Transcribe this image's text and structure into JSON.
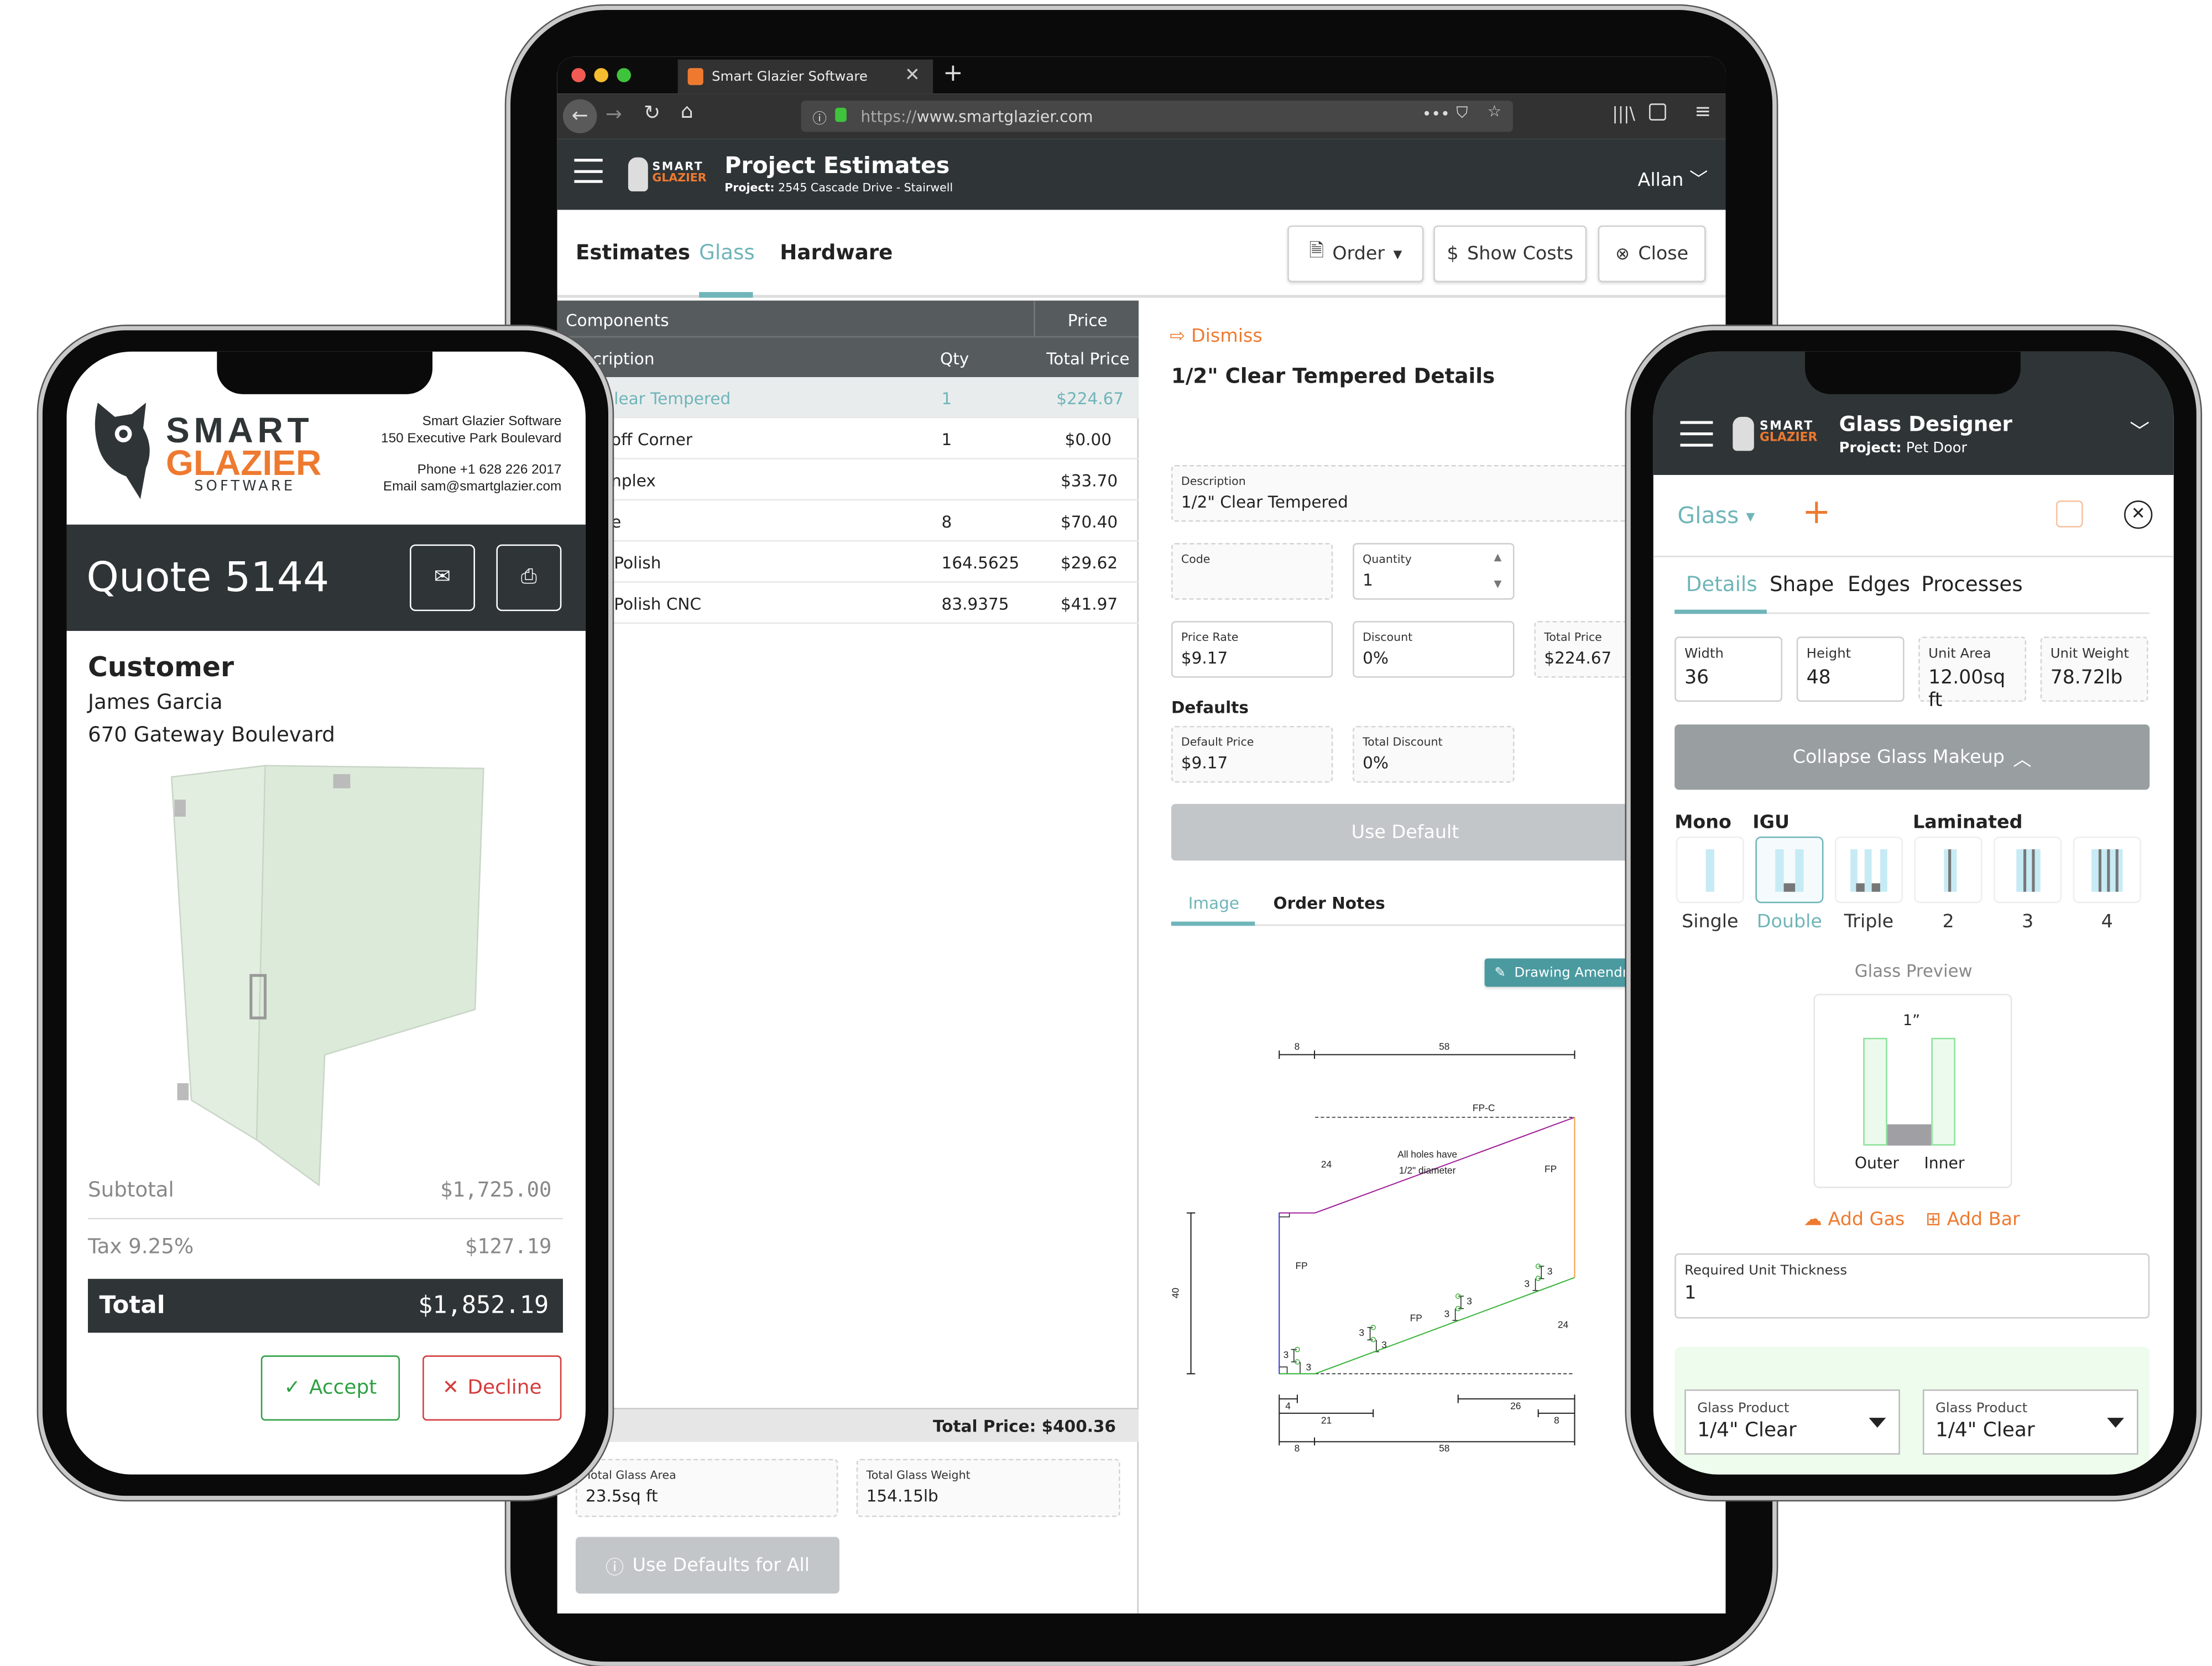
{
  "browser": {
    "tab_title": "Smart Glazier Software",
    "url_prefix": "https://",
    "url": "www.smartglazier.com"
  },
  "app": {
    "title": "Project Estimates",
    "project_label": "Project:",
    "project_value": "2545 Cascade Drive - Stairwell",
    "user": "Allan",
    "logo_text": "SMART GLAZIER SOFTWARE"
  },
  "nav": {
    "tabs": [
      "Estimates",
      "Glass",
      "Hardware"
    ],
    "active_tab": "Glass",
    "order": "Order",
    "show_costs": "Show Costs",
    "close": "Close"
  },
  "table": {
    "group_headers": [
      "Components",
      "Price"
    ],
    "columns": [
      "cription",
      "Qty",
      "Total Price"
    ],
    "rows": [
      {
        "desc": "lear Tempered",
        "qty": "1",
        "price": "$224.67",
        "selected": true
      },
      {
        "desc": "off Corner",
        "qty": "1",
        "price": "$0.00"
      },
      {
        "desc": "nplex",
        "qty": "",
        "price": "$33.70"
      },
      {
        "desc": "e",
        "qty": "8",
        "price": "$70.40"
      },
      {
        "desc": "Polish",
        "qty": "164.5625",
        "price": "$29.62"
      },
      {
        "desc": "Polish CNC",
        "qty": "83.9375",
        "price": "$41.97"
      }
    ],
    "total": "Total Price: $400.36"
  },
  "summary": {
    "area_label": "Total Glass Area",
    "area_value": "23.5sq ft",
    "weight_label": "Total Glass Weight",
    "weight_value": "154.15lb",
    "use_defaults": "Use Defaults for All"
  },
  "details": {
    "dismiss": "Dismiss",
    "title": "1/2\" Clear Tempered Details",
    "description_label": "Description",
    "description_value": "1/2\" Clear Tempered",
    "code_label": "Code",
    "code_value": "",
    "quantity_label": "Quantity",
    "quantity_value": "1",
    "price_rate_label": "Price Rate",
    "price_rate_value": "$9.17",
    "discount_label": "Discount",
    "discount_value": "0%",
    "total_price_label": "Total Price",
    "total_price_value": "$224.67",
    "defaults_heading": "Defaults",
    "default_price_label": "Default Price",
    "default_price_value": "$9.17",
    "total_discount_label": "Total Discount",
    "total_discount_value": "0%",
    "use_default": "Use Default",
    "tabs": [
      "Image",
      "Order Notes"
    ],
    "active_tab": "Image",
    "drawing_amendment": "Drawing Amendr"
  },
  "drawing": {
    "d8": "8",
    "d58": "58",
    "fpc": "FP-C",
    "note1": "All holes have",
    "note2": "1/2\" diameter",
    "d24": "24",
    "fp": "FP",
    "d40": "40",
    "d3": "3",
    "d4": "4",
    "d21": "21",
    "d26": "26"
  },
  "quote": {
    "company": "Smart Glazier Software",
    "address": "150 Executive Park Boulevard",
    "phone": "Phone +1 628 226 2017",
    "email": "Email sam@smartglazier.com",
    "logo_smart": "SMART",
    "logo_glazier": "GLAZIER",
    "logo_software": "SOFTWARE",
    "title": "Quote 5144",
    "customer_heading": "Customer",
    "customer_name": "James Garcia",
    "customer_address": "670 Gateway Boulevard",
    "subtotal_label": "Subtotal",
    "subtotal_value": "$1,725.00",
    "tax_label": "Tax 9.25%",
    "tax_value": "$127.19",
    "total_label": "Total",
    "total_value": "$1,852.19",
    "accept": "Accept",
    "decline": "Decline"
  },
  "designer": {
    "title": "Glass Designer",
    "project_label": "Project:",
    "project_value": "Pet Door",
    "glass_menu": "Glass",
    "tabs": [
      "Details",
      "Shape",
      "Edges",
      "Processes"
    ],
    "active_tab": "Details",
    "width_label": "Width",
    "width_value": "36",
    "height_label": "Height",
    "height_value": "48",
    "area_label": "Unit Area",
    "area_value": "12.00sq ft",
    "weight_label": "Unit Weight",
    "weight_value": "78.72lb",
    "collapse": "Collapse Glass Makeup",
    "groups": [
      "Mono",
      "IGU",
      "Laminated"
    ],
    "options": [
      "Single",
      "Double",
      "Triple",
      "2",
      "3",
      "4"
    ],
    "selected_option": "Double",
    "preview_title": "Glass Preview",
    "preview_thickness": "1”",
    "outer": "Outer",
    "inner": "Inner",
    "add_gas": "Add Gas",
    "add_bar": "Add Bar",
    "thickness_label": "Required Unit Thickness",
    "thickness_value": "1",
    "product_label": "Glass Product",
    "outer_product": "1/4\" Clear",
    "inner_product": "1/4\" Clear"
  },
  "colors": {
    "teal": "#6fb5b9",
    "orange": "#ee7a30",
    "dark": "#2f3436",
    "accept": "#2ea043",
    "decline": "#d43c3c"
  }
}
